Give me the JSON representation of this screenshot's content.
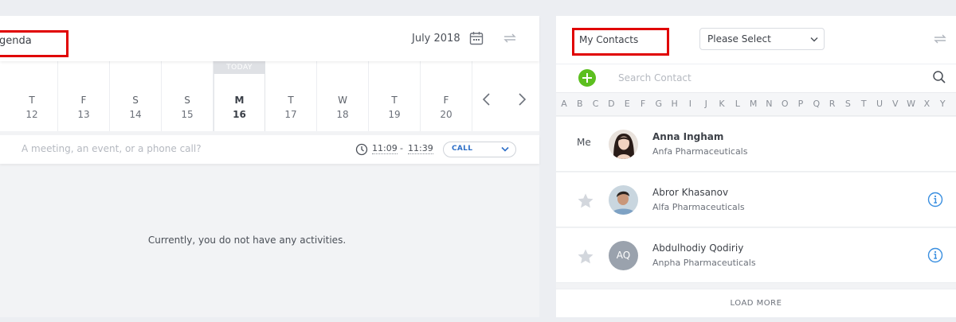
{
  "agenda": {
    "title": "genda",
    "month": "July 2018",
    "days": [
      {
        "letter": "T",
        "num": "12"
      },
      {
        "letter": "F",
        "num": "13"
      },
      {
        "letter": "S",
        "num": "14"
      },
      {
        "letter": "S",
        "num": "15"
      },
      {
        "letter": "M",
        "num": "16"
      },
      {
        "letter": "T",
        "num": "17"
      },
      {
        "letter": "W",
        "num": "18"
      },
      {
        "letter": "T",
        "num": "19"
      },
      {
        "letter": "F",
        "num": "20"
      }
    ],
    "today_badge": "TODAY",
    "activity_placeholder": "A meeting, an event, or a phone call?",
    "time_start": "11:09",
    "time_sep": "-",
    "time_end": "11:39",
    "activity_type": "CALL",
    "empty_message": "Currently, you do not have any activities."
  },
  "contacts": {
    "title": "My Contacts",
    "select_value": "Please Select",
    "search_placeholder": "Search Contact",
    "alphabet": [
      "A",
      "B",
      "C",
      "D",
      "E",
      "F",
      "G",
      "H",
      "I",
      "J",
      "K",
      "L",
      "M",
      "N",
      "O",
      "P",
      "Q",
      "R",
      "S",
      "T",
      "U",
      "V",
      "W",
      "X",
      "Y"
    ],
    "me_label": "Me",
    "list": [
      {
        "name": "Anna Ingham",
        "company": "Anfa Pharmaceuticals"
      },
      {
        "name": "Abror Khasanov",
        "company": "Alfa Pharmaceuticals"
      },
      {
        "name": "Abdulhodiy Qodiriy",
        "company": "Anpha Pharmaceuticals",
        "initials": "AQ"
      }
    ],
    "load_more": "LOAD MORE"
  },
  "colors": {
    "highlight_border": "#e00000",
    "add_green": "#5cbf1f",
    "link_blue": "#2e6fc7",
    "info_blue": "#3a8fe0"
  }
}
